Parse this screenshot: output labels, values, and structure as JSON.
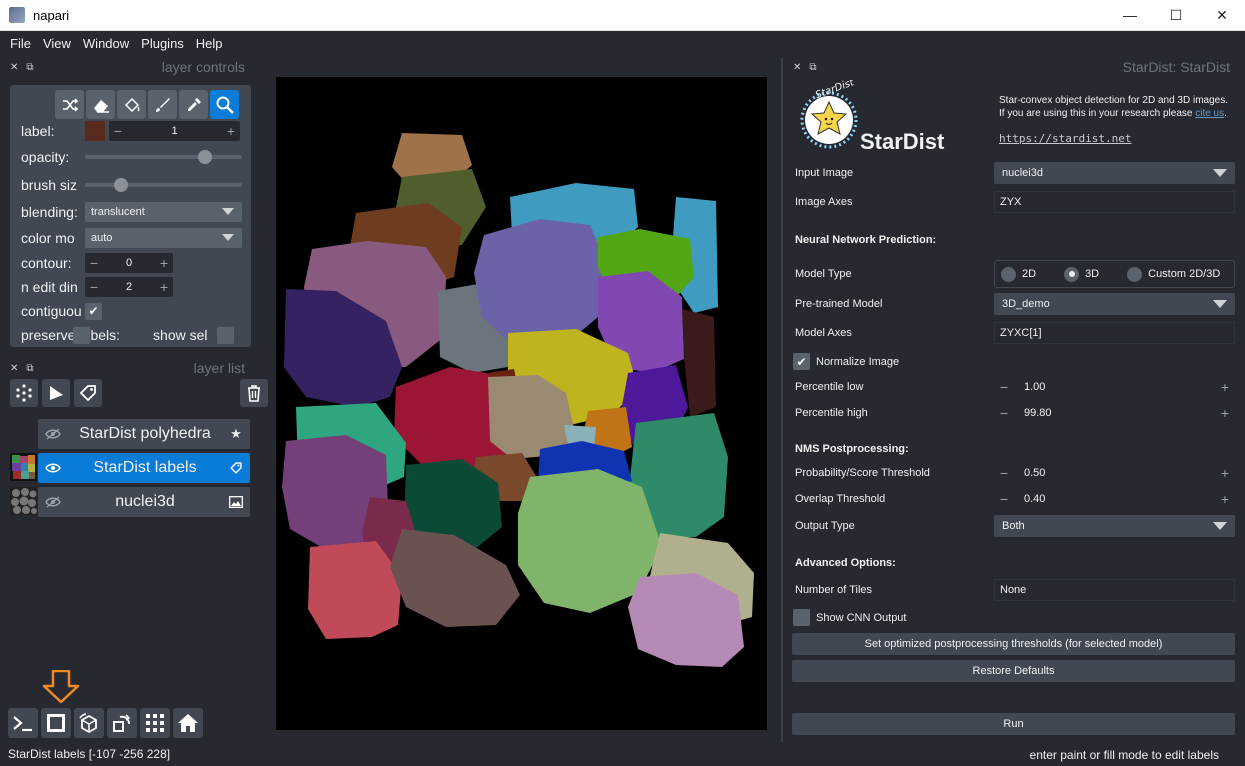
{
  "window": {
    "title": "napari",
    "minimize": "—",
    "maximize": "☐",
    "close": "✕"
  },
  "menu": [
    "File",
    "View",
    "Window",
    "Plugins",
    "Help"
  ],
  "layer_controls": {
    "header": "layer controls",
    "label_label": "label:",
    "label_value": "1",
    "label_color": "#5b2a1e",
    "opacity_label": "opacity:",
    "opacity_value": 0.79,
    "brush_label": "brush siz",
    "brush_value": 0.2,
    "blending_label": "blending:",
    "blending_value": "translucent",
    "color_mode_label": "color mo",
    "color_mode_value": "auto",
    "contour_label": "contour:",
    "contour_value": "0",
    "n_edit_label": "n edit din",
    "n_edit_value": "2",
    "contiguous_label": "contiguou",
    "preserve_label": "preserve l",
    "preserve_label_rest": "bels:",
    "show_sel_label": "show sel"
  },
  "layer_list": {
    "header": "layer list",
    "layers": [
      {
        "name": "StarDist polyhedra",
        "selected": false
      },
      {
        "name": "StarDist labels",
        "selected": true
      },
      {
        "name": "nuclei3d",
        "selected": false
      }
    ]
  },
  "stardist": {
    "header": "StarDist: StarDist",
    "logo_word": "StarDist",
    "logo_arc": "StarDist",
    "desc_line1": "Star-convex object detection for 2D and 3D images.",
    "desc_line2": "If you are using this in your research please ",
    "desc_link": "cite us",
    "desc_end": ".",
    "url": "https://stardist.net",
    "input_image_label": "Input Image",
    "input_image_value": "nuclei3d",
    "image_axes_label": "Image Axes",
    "image_axes_value": "ZYX",
    "nn_section": "Neural Network Prediction:",
    "model_type_label": "Model Type",
    "model_type_options": [
      "2D",
      "3D",
      "Custom 2D/3D"
    ],
    "model_type_selected": "3D",
    "pretrained_label": "Pre-trained Model",
    "pretrained_value": "3D_demo",
    "model_axes_label": "Model Axes",
    "model_axes_value": "ZYXC[1]",
    "normalize_label": "Normalize Image",
    "perc_low_label": "Percentile low",
    "perc_low_value": "1.00",
    "perc_high_label": "Percentile high",
    "perc_high_value": "99.80",
    "nms_section": "NMS Postprocessing:",
    "prob_label": "Probability/Score Threshold",
    "prob_value": "0.50",
    "overlap_label": "Overlap Threshold",
    "overlap_value": "0.40",
    "output_type_label": "Output Type",
    "output_type_value": "Both",
    "adv_section": "Advanced Options:",
    "tiles_label": "Number of Tiles",
    "tiles_value": "None",
    "cnn_label": "Show CNN Output",
    "opt_button": "Set optimized postprocessing thresholds (for selected model)",
    "restore_button": "Restore Defaults",
    "run_button": "Run"
  },
  "status": {
    "left": "StarDist labels [-107 -256  228]",
    "right": "enter paint or fill mode to edit labels"
  },
  "colors": {
    "accent": "#0a7bd7",
    "background": "#262930",
    "panel": "#414851",
    "arrow": "#f08a24"
  }
}
